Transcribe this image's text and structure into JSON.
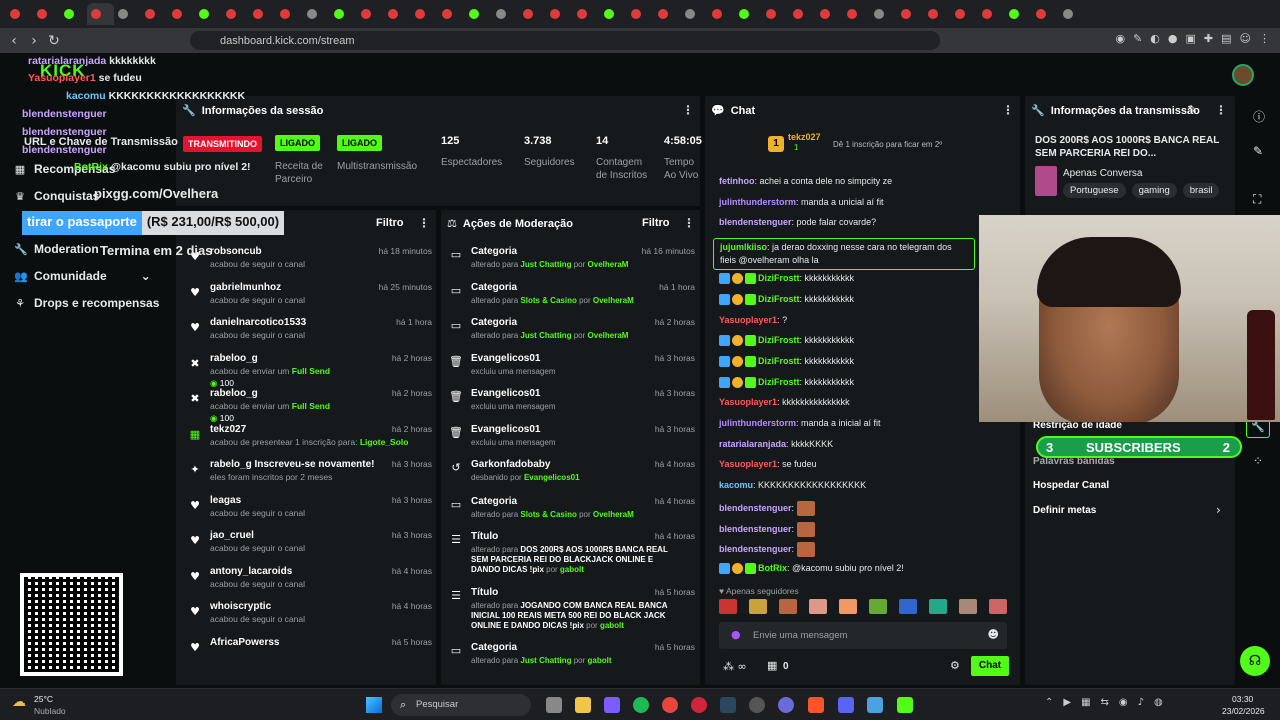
{
  "browser": {
    "address": "dashboard.kick.com/stream"
  },
  "overlay": {
    "chat_lines": [
      {
        "user": "ratarialaranjada",
        "text": "kkkkkkkk"
      },
      {
        "user": "Yasuoplayer1",
        "text": "se fudeu"
      },
      {
        "user": "kacomu",
        "text": "KKKKKKKKKKKKKKKKKK"
      },
      {
        "user": "blendenstenguer",
        "text": ""
      },
      {
        "user": "blendenstenguer",
        "text": ""
      },
      {
        "user": "blendenstenguer",
        "text": ""
      },
      {
        "user": "BotRix",
        "text": "@kacomu subiu pro nível 2!"
      }
    ],
    "brand": "KICK",
    "url_line": "URL e Chave de Transmissão",
    "pix": "pixgg.com/Ovelhera",
    "goal_text": "tirar o passaporte",
    "goal_value": "(R$ 231,00/R$ 500,00)",
    "timer": "Termina em 2 dias",
    "subs_left": "3",
    "subs_label": "SUBSCRIBERS",
    "subs_right": "2"
  },
  "sidebar": {
    "items": [
      "Recompensas",
      "Conquistas",
      "Moderation",
      "Comunidade",
      "Drops e recompensas"
    ]
  },
  "session": {
    "title": "Informações da sessão",
    "badges": [
      "TRANSMITINDO",
      "LIGADO",
      "LIGADO"
    ],
    "labels": [
      "Receita de Parceiro",
      "Multistransmissão"
    ],
    "stats": [
      {
        "value": "125",
        "label": "Espectadores"
      },
      {
        "value": "3.738",
        "label": "Seguidores"
      },
      {
        "value": "14",
        "label": "Contagem de Inscritos"
      },
      {
        "value": "4:58:05",
        "label": "Tempo Ao Vivo"
      }
    ]
  },
  "activity": {
    "filter": "Filtro",
    "items": [
      {
        "icon": "heart",
        "name": "robsoncub",
        "sub": "acabou de seguir o canal",
        "time": "há 18 minutos"
      },
      {
        "icon": "heart",
        "name": "gabrielmunhoz",
        "sub": "acabou de seguir o canal",
        "time": "há 25 minutos"
      },
      {
        "icon": "heart",
        "name": "danielnarcotico1533",
        "sub": "acabou de seguir o canal",
        "time": "há 1 hora"
      },
      {
        "icon": "x",
        "name": "rabeloo_g",
        "sub": "acabou de enviar um",
        "hl": "Full Send",
        "extra": "100",
        "time": "há 2 horas"
      },
      {
        "icon": "x",
        "name": "rabeloo_g",
        "sub": "acabou de enviar um",
        "hl": "Full Send",
        "extra": "100",
        "time": "há 2 horas"
      },
      {
        "icon": "gift",
        "name": "tekz027",
        "sub": "acabou de presentear 1 inscrição para:",
        "hl": "Ligote_Solo",
        "time": "há 2 horas"
      },
      {
        "icon": "star",
        "name": "rabelo_g Inscreveu-se novamente!",
        "sub": "eles foram inscritos por 2 meses",
        "time": "há 3 horas"
      },
      {
        "icon": "heart",
        "name": "leagas",
        "sub": "acabou de seguir o canal",
        "time": "há 3 horas"
      },
      {
        "icon": "heart",
        "name": "jao_cruel",
        "sub": "acabou de seguir o canal",
        "time": "há 3 horas"
      },
      {
        "icon": "heart",
        "name": "antony_lacaroids",
        "sub": "acabou de seguir o canal",
        "time": "há 4 horas"
      },
      {
        "icon": "heart",
        "name": "whoiscryptic",
        "sub": "acabou de seguir o canal",
        "time": "há 4 horas"
      },
      {
        "icon": "heart",
        "name": "AfricaPowerss",
        "sub": "",
        "time": "há 5 horas"
      }
    ]
  },
  "mod": {
    "title": "Ações de Moderação",
    "filter": "Filtro",
    "items": [
      {
        "icon": "cat",
        "name": "Categoria",
        "pre": "alterado para",
        "val": "Just Chatting",
        "by": "por",
        "who": "OvelheraM",
        "time": "há 16 minutos"
      },
      {
        "icon": "cat",
        "name": "Categoria",
        "pre": "alterado para",
        "val": "Slots & Casino",
        "by": "por",
        "who": "OvelheraM",
        "time": "há 1 hora"
      },
      {
        "icon": "cat",
        "name": "Categoria",
        "pre": "alterado para",
        "val": "Just Chatting",
        "by": "por",
        "who": "OvelheraM",
        "time": "há 2 horas"
      },
      {
        "icon": "del",
        "name": "Evangelicos01",
        "pre": "excluiu uma mensagem",
        "val": "",
        "by": "",
        "who": "",
        "time": "há 3 horas"
      },
      {
        "icon": "del",
        "name": "Evangelicos01",
        "pre": "excluiu uma mensagem",
        "val": "",
        "by": "",
        "who": "",
        "time": "há 3 horas"
      },
      {
        "icon": "del",
        "name": "Evangelicos01",
        "pre": "excluiu uma mensagem",
        "val": "",
        "by": "",
        "who": "",
        "time": "há 3 horas"
      },
      {
        "icon": "undo",
        "name": "Garkonfadobaby",
        "pre": "desbanido por",
        "val": "Evangelicos01",
        "by": "",
        "who": "",
        "time": "há 4 horas"
      },
      {
        "icon": "cat",
        "name": "Categoria",
        "pre": "alterado para",
        "val": "Slots & Casino",
        "by": "por",
        "who": "OvelheraM",
        "time": "há 4 horas"
      },
      {
        "icon": "title",
        "name": "Título",
        "pre": "alterado para",
        "val": "DOS 200R$ AOS 1000R$ BANCA REAL SEM PARCERIA REI DO BLACKJACK ONLINE E DANDO DICAS !pix",
        "by": "por",
        "who": "gabolt",
        "time": "há 4 horas"
      },
      {
        "icon": "title",
        "name": "Título",
        "pre": "alterado para",
        "val": "JOGANDO COM BANCA REAL BANCA INICIAL 100 REAIS META 500 REI DO BLACK JACK ONLINE E DANDO DICAS !pix",
        "by": "por",
        "who": "gabolt",
        "time": "há 5 horas"
      },
      {
        "icon": "cat",
        "name": "Categoria",
        "pre": "alterado para",
        "val": "Just Chatting",
        "by": "por",
        "who": "gabolt",
        "time": "há 5 horas"
      }
    ]
  },
  "chat": {
    "title": "Chat",
    "pinned_user": "tekz027",
    "pinned_count": "1",
    "pinned_text": "Dê 1 inscrição para ficar em 2º",
    "messages": [
      {
        "user": "fetinhoo",
        "color": "#c8a5ff",
        "text": "achei a conta dele no simpcity ze"
      },
      {
        "user": "julinthunderstorm",
        "color": "#b48cff",
        "text": "manda a unicial aí fit"
      },
      {
        "user": "blendenstenguer",
        "color": "#c8a5ff",
        "text": "pode falar covarde?"
      },
      {
        "user": "jujumlkiiso",
        "color": "#53fc18",
        "text": "ja derao doxxing nesse cara no telegram dos fieis @ovelheram olha la"
      },
      {
        "user": "DiziFrostt",
        "color": "#53fc18",
        "text": "kkkkkkkkkkk",
        "badges": true
      },
      {
        "user": "DiziFrostt",
        "color": "#53fc18",
        "text": "kkkkkkkkkkk",
        "badges": true
      },
      {
        "user": "Yasuoplayer1",
        "color": "#ff5a5a",
        "text": "?"
      },
      {
        "user": "DiziFrostt",
        "color": "#53fc18",
        "text": "kkkkkkkkkkk",
        "badges": true
      },
      {
        "user": "DiziFrostt",
        "color": "#53fc18",
        "text": "kkkkkkkkkkk",
        "badges": true
      },
      {
        "user": "DiziFrostt",
        "color": "#53fc18",
        "text": "kkkkkkkkkkk",
        "badges": true
      },
      {
        "user": "Yasuoplayer1",
        "color": "#ff5a5a",
        "text": "kkkkkkkkkkkkkkk"
      },
      {
        "user": "julinthunderstorm",
        "color": "#b48cff",
        "text": "manda a inicial aí fit"
      },
      {
        "user": "ratarialaranjada",
        "color": "#c8a5ff",
        "text": "kkkkKKKK"
      },
      {
        "user": "Yasuoplayer1",
        "color": "#ff5a5a",
        "text": "se fudeu"
      },
      {
        "user": "kacomu",
        "color": "#6cc6ff",
        "text": "KKKKKKKKKKKKKKKKKK"
      },
      {
        "user": "blendenstenguer",
        "color": "#c8a5ff",
        "text": "",
        "emote": true
      },
      {
        "user": "blendenstenguer",
        "color": "#c8a5ff",
        "text": "",
        "emote": true
      },
      {
        "user": "blendenstenguer",
        "color": "#c8a5ff",
        "text": "",
        "emote": true
      },
      {
        "user": "BotRix",
        "color": "#53fc18",
        "text": "@kacomu subiu pro nível 2!",
        "badges": true
      }
    ],
    "followers_only": "Apenas seguidores",
    "input_placeholder": "Envie uma mensagem",
    "points": "0",
    "send": "Chat"
  },
  "stream": {
    "title": "Informações da transmissão",
    "stream_title": "DOS 200R$ AOS 1000R$ BANCA REAL SEM PARCERIA REI DO...",
    "category": "Apenas Conversa",
    "tags": [
      "Portuguese",
      "gaming",
      "brasil"
    ],
    "menu": [
      "Restrição de idade",
      "Palavras banidas",
      "Hospedar Canal",
      "Definir metas"
    ]
  },
  "taskbar": {
    "temp": "25°C",
    "weather": "Nublado",
    "search": "Pesquisar",
    "time": "03:30",
    "date": "23/02/2026"
  },
  "colors": {
    "accent": "#53fc18",
    "bg": "#0b0e0f",
    "panel": "#16191b",
    "live": "#e7122e"
  }
}
